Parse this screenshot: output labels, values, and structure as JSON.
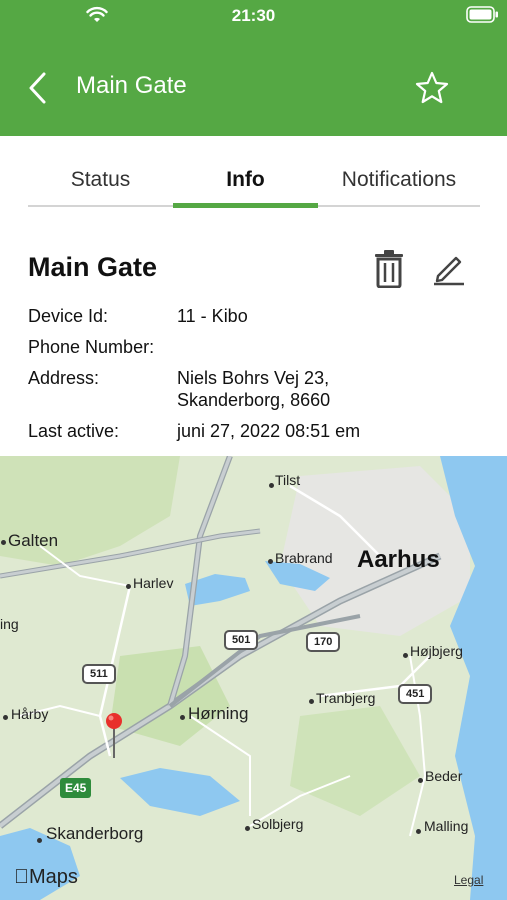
{
  "status_bar": {
    "time": "21:30"
  },
  "nav": {
    "title": "Main Gate"
  },
  "tabs": [
    {
      "label": "Status"
    },
    {
      "label": "Info"
    },
    {
      "label": "Notifications"
    }
  ],
  "device": {
    "name": "Main Gate",
    "device_id_label": "Device Id:",
    "device_id": "11 - Kibo",
    "phone_label": "Phone Number:",
    "phone": "",
    "address_label": "Address:",
    "address_line1": "Niels Bohrs Vej 23,",
    "address_line2": "Skanderborg, 8660",
    "last_active_label": "Last active:",
    "last_active": "juni 27, 2022 08:51 em"
  },
  "map": {
    "places": {
      "tilst": "Tilst",
      "galten": "Galten",
      "brabrand": "Brabrand",
      "aarhus": "Aarhus",
      "harlev": "Harlev",
      "ing": "ing",
      "hojbjerg": "Højbjerg",
      "harby": "Hårby",
      "horning": "Hørning",
      "tranbjerg": "Tranbjerg",
      "beder": "Beder",
      "skanderborg": "Skanderborg",
      "solbjerg": "Solbjerg",
      "malling": "Malling"
    },
    "roads": {
      "r501": "501",
      "r170": "170",
      "r511": "511",
      "r451": "451",
      "e45": "E45"
    },
    "logo": "Maps",
    "legal": "Legal"
  },
  "colors": {
    "accent": "#55a844",
    "water": "#8ec8f0",
    "land": "#dfe9d1"
  }
}
